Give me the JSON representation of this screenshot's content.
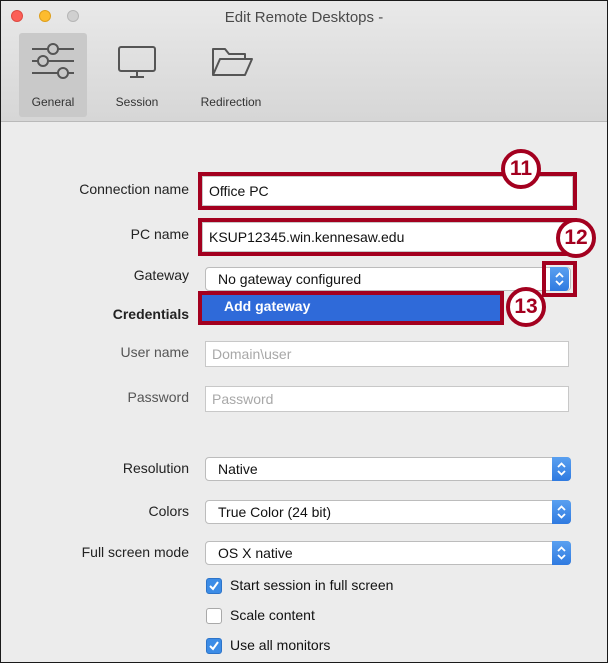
{
  "window": {
    "title": "Edit Remote Desktops -"
  },
  "toolbar": {
    "tabs": [
      {
        "label": "General",
        "icon": "sliders-icon",
        "active": true
      },
      {
        "label": "Session",
        "icon": "monitor-icon"
      },
      {
        "label": "Redirection",
        "icon": "folder-icon"
      }
    ]
  },
  "form": {
    "connection_name": {
      "label": "Connection name",
      "value": "Office PC"
    },
    "pc_name": {
      "label": "PC name",
      "value": "KSUP12345.win.kennesaw.edu"
    },
    "gateway": {
      "label": "Gateway",
      "value": "No gateway configured",
      "option_highlighted": "Add gateway"
    },
    "credentials": {
      "label": "Credentials"
    },
    "user_name": {
      "label": "User name",
      "placeholder": "Domain\\user"
    },
    "password": {
      "label": "Password",
      "placeholder": "Password"
    },
    "resolution": {
      "label": "Resolution",
      "value": "Native"
    },
    "colors": {
      "label": "Colors",
      "value": "True Color (24 bit)"
    },
    "fullscreen_mode": {
      "label": "Full screen mode",
      "value": "OS X native"
    },
    "checkboxes": [
      {
        "label": "Start session in full screen",
        "checked": true
      },
      {
        "label": "Scale content",
        "checked": false
      },
      {
        "label": "Use all monitors",
        "checked": true
      }
    ]
  },
  "annotations": {
    "a11": "11",
    "a12": "12",
    "a13": "13"
  },
  "colors": {
    "annotation": "#a3001f",
    "accent": "#3c8ce6",
    "highlight": "#2f6ad9"
  }
}
